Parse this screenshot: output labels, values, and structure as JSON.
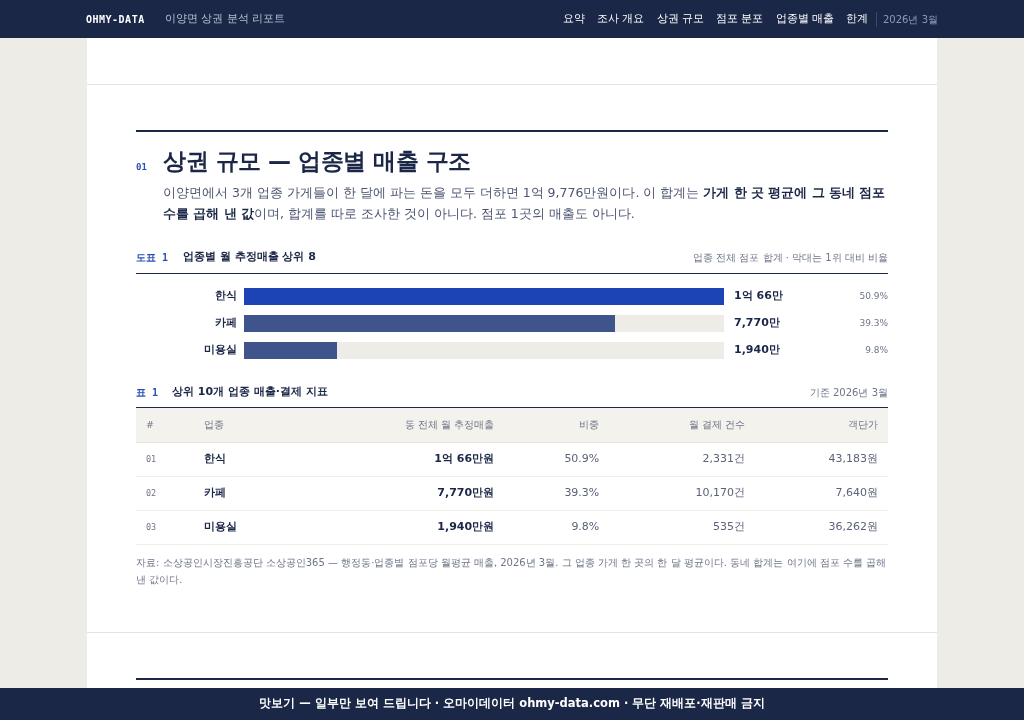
{
  "navbar": {
    "brand": "OHMY-DATA",
    "subtitle": "이양면 상권 분석 리포트",
    "links": [
      {
        "label": "요약",
        "selected": false
      },
      {
        "label": "조사 개요",
        "selected": false
      },
      {
        "label": "상권 규모",
        "selected": false
      },
      {
        "label": "점포 분포",
        "selected": false
      },
      {
        "label": "업종별 매출",
        "selected": false
      },
      {
        "label": "한계",
        "selected": false
      }
    ],
    "date": "2026년 3월"
  },
  "section": {
    "number": "01",
    "title": "상권 규모 — 업종별 매출 구조",
    "lead": "이양면에서 3개 업종 가게들이 한 달에 파는 돈을 모두 더하면 1억 9,776만원이다. 이 합계는 **가게 한 곳 평균에 그 동네 점포 수를 곱해 낸 값**이며, 합계를 따로 조사한 것이 아니다. 점포 1곳의 매출도 아니다."
  },
  "figure": {
    "tag": "도표 1",
    "title": "업종별 월 추정매출 상위 8",
    "note": "업종 전체 점포 합계 · 막대는 1위 대비 비율",
    "bars": [
      {
        "label": "한식",
        "level": 1.0,
        "color": "#1c44b4",
        "value": "1억 66만",
        "share": "50.9%"
      },
      {
        "label": "카페",
        "level": 0.772,
        "color": "#3e548b",
        "value": "7,770만",
        "share": "39.3%"
      },
      {
        "label": "미용실",
        "level": 0.193,
        "color": "#3e548b",
        "value": "1,940만",
        "share": "9.8%"
      }
    ]
  },
  "table": {
    "tag": "표 1",
    "title": "상위 10개 업종 매출·결제 지표",
    "note": "기준 2026년 3월",
    "columns": [
      "#",
      "업종",
      "동 전체 월 추정매출",
      "비중",
      "월 결제 건수",
      "객단가"
    ],
    "rows": [
      [
        "01",
        "한식",
        "1억 66만원",
        "50.9%",
        "2,331건",
        "43,183원"
      ],
      [
        "02",
        "카페",
        "7,770만원",
        "39.3%",
        "10,170건",
        "7,640원"
      ],
      [
        "03",
        "미용실",
        "1,940만원",
        "9.8%",
        "535건",
        "36,262원"
      ]
    ],
    "source": "자료: 소상공인시장진흥공단 소상공인365 — 행정동·업종별 점포당 월평균 매출, 2026년 3월. 그 업종 가게 한 곳의 한 달 평균이다. 동네 합계는 여기에 점포 수를 곱해 낸 값이다."
  },
  "footer": "맛보기 — 일부만 보여 드립니다 · 오마이데이터 ohmy-data.com · 무단 재배포·재판매 금지"
}
